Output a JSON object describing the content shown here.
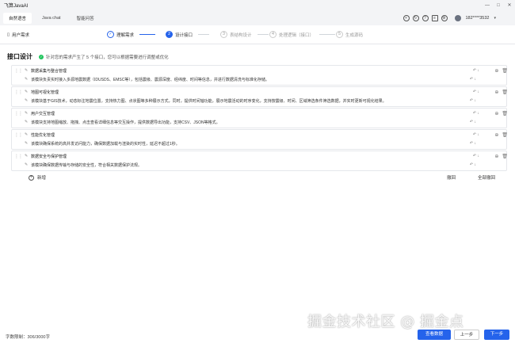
{
  "window": {
    "title": "飞算JavaAI",
    "controls": [
      "—",
      "□",
      "✕"
    ]
  },
  "tabs": [
    {
      "label": "自然语言",
      "active": true
    },
    {
      "label": "Java chat",
      "active": false
    },
    {
      "label": "智能问答",
      "active": false
    }
  ],
  "topbar": {
    "icons": [
      "add-circle-icon",
      "refresh-icon",
      "help-icon",
      "docs-icon",
      "settings-icon"
    ],
    "username": "182****3532"
  },
  "steps": {
    "requirement_label": "用户需求",
    "items": [
      {
        "num": "✓",
        "label": "理解需求",
        "state": "done"
      },
      {
        "num": "2",
        "label": "设计接口",
        "state": "current"
      },
      {
        "num": "3",
        "label": "表结构设计",
        "state": "todo"
      },
      {
        "num": "4",
        "label": "处理逻辑（接口）",
        "state": "todo"
      },
      {
        "num": "5",
        "label": "生成源码",
        "state": "todo"
      }
    ]
  },
  "main": {
    "title": "接口设计",
    "notice": "针对您的需求产生了 5 个接口，您可以根据需要进行调整或优化",
    "interfaces": [
      {
        "title": "数据采集与整合管理",
        "desc": "该模块负责实时接入多源地震数据（IDUSDS、EMSC等），包括震级、震源深度、经纬度、时间等信息，并进行数据清洗与标准化存储。"
      },
      {
        "title": "地图可视化管理",
        "desc": "该模块基于GIS技术，动态标注地震位置，支持热力图、点状图等多种展示方式，同时，提供时间轴功能，展示地震活动的时序变化，支持按震级、时间、区域筛选条件筛选数据，并实时更新可视化结果。"
      },
      {
        "title": "用户交互管理",
        "desc": "该模块支持地图缩放、拖拽、点击查看详细信息等交互操作，提供数据导出功能，支持CSV、JSON等格式。"
      },
      {
        "title": "性能优化管理",
        "desc": "该模块确保系统的高并发访问能力，确保数据加载与渲染的实时性，延迟不超过1秒。"
      },
      {
        "title": "数据安全与保护管理",
        "desc": "该模块确保数据传输与存储的安全性，符合相关数据保护法规。"
      }
    ],
    "add_label": "新增",
    "undo_label": "撤回",
    "undo_all_label": "全部撤回"
  },
  "footer": {
    "char_count": "字数限制：306/3000字",
    "view_button": "查看数据",
    "prev_button": "上一步",
    "next_button": "下一步"
  },
  "watermark": "掘金技术社区 @ 掘金点",
  "accent": "#2563eb"
}
